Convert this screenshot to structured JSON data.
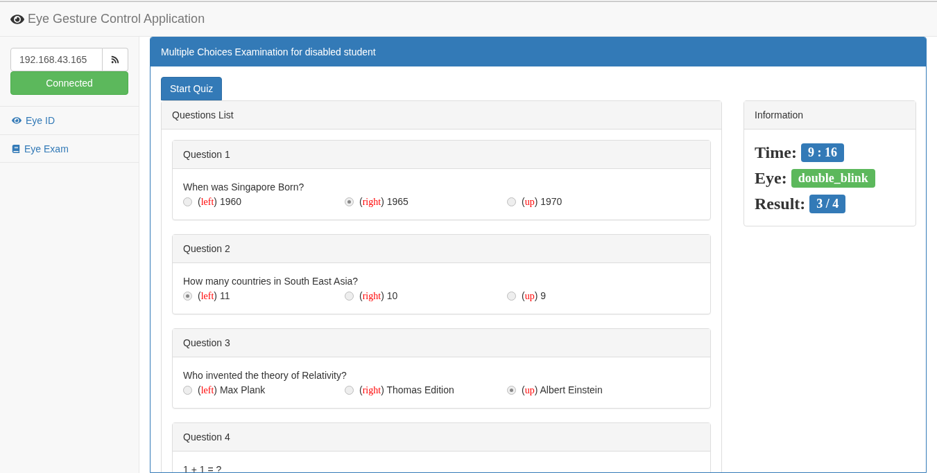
{
  "app": {
    "title": "Eye Gesture Control Application"
  },
  "connection": {
    "address": "192.168.43.165",
    "status": "Connected",
    "connected": true
  },
  "nav": [
    {
      "label": "Eye ID",
      "kind": "eye"
    },
    {
      "label": "Eye Exam",
      "kind": "book"
    }
  ],
  "panel": {
    "title": "Multiple Choices Examination for disabled student",
    "start_button": "Start Quiz"
  },
  "questions_list": {
    "title": "Questions List",
    "questions": [
      {
        "title": "Question 1",
        "text": "When was Singapore Born?",
        "options": [
          {
            "cue": "(left)",
            "answer": "1960",
            "selected": false
          },
          {
            "cue": "(right)",
            "answer": "1965",
            "selected": true
          },
          {
            "cue": "(up)",
            "answer": "1970",
            "selected": false
          }
        ]
      },
      {
        "title": "Question 2",
        "text": "How many countries in South East Asia?",
        "options": [
          {
            "cue": "(left)",
            "answer": "11",
            "selected": true
          },
          {
            "cue": "(right)",
            "answer": "10",
            "selected": false
          },
          {
            "cue": "(up)",
            "answer": "9",
            "selected": false
          }
        ]
      },
      {
        "title": "Question 3",
        "text": "Who invented the theory of Relativity?",
        "options": [
          {
            "cue": "(left)",
            "answer": "Max Plank",
            "selected": false
          },
          {
            "cue": "(right)",
            "answer": "Thomas Edition",
            "selected": false
          },
          {
            "cue": "(up)",
            "answer": "Albert Einstein",
            "selected": true
          }
        ]
      },
      {
        "title": "Question 4",
        "text": "1 + 1 = ?"
      }
    ]
  },
  "information": {
    "title": "Information",
    "items": [
      {
        "label": "Time:",
        "value": "9 : 16",
        "color": "#337ab7"
      },
      {
        "label": "Eye:",
        "value": "double_blink",
        "color": "#5cb85c"
      },
      {
        "label": "Result:",
        "value": "3 / 4",
        "color": "#337ab7"
      }
    ]
  }
}
